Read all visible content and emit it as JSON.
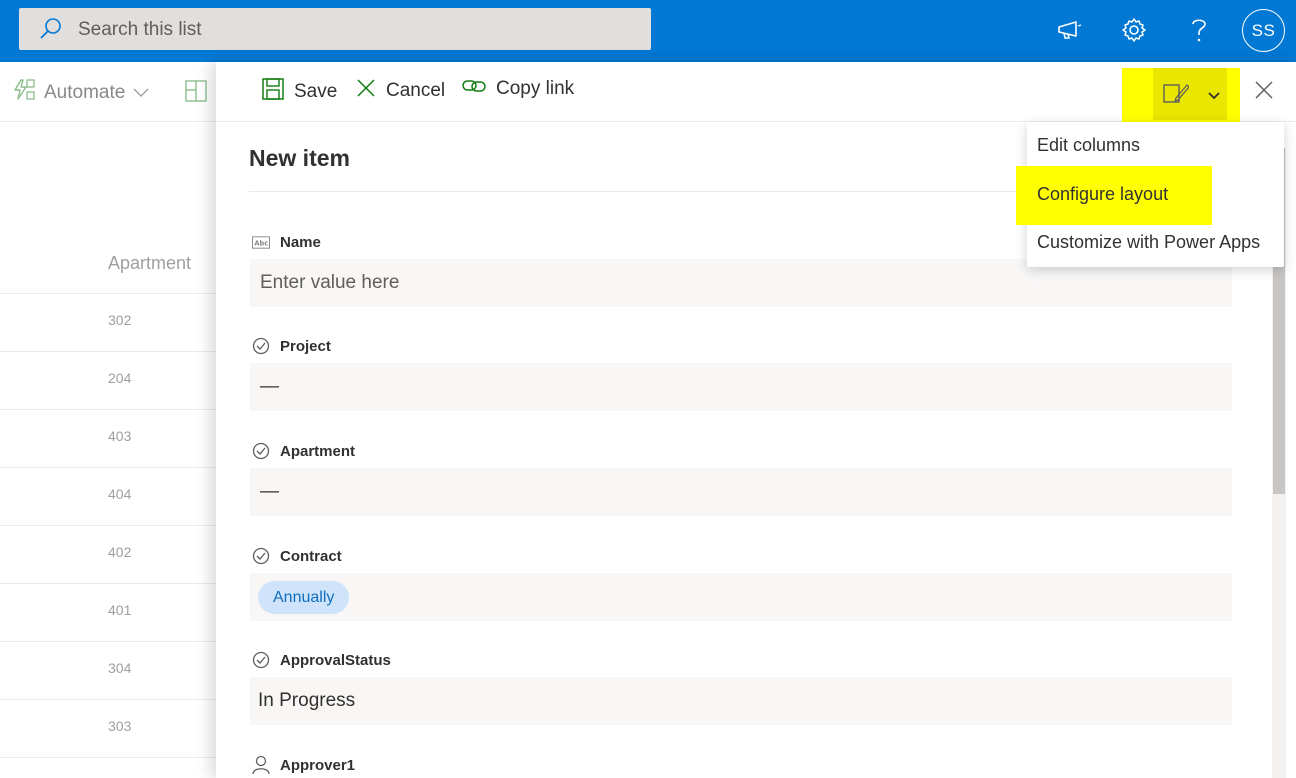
{
  "suitebar": {
    "search_placeholder": "Search this list",
    "avatar_initials": "SS"
  },
  "background_list": {
    "automate_label": "Automate",
    "column_header": "Apartment",
    "rows": [
      "302",
      "204",
      "403",
      "404",
      "402",
      "401",
      "304",
      "303"
    ]
  },
  "panel": {
    "commands": {
      "save": "Save",
      "cancel": "Cancel",
      "copy_link": "Copy link"
    },
    "title": "New item",
    "fields": {
      "name": {
        "label": "Name",
        "placeholder": "Enter value here"
      },
      "project": {
        "label": "Project",
        "value": "—"
      },
      "apartment": {
        "label": "Apartment",
        "value": "—"
      },
      "contract": {
        "label": "Contract",
        "value": "Annually"
      },
      "approval_status": {
        "label": "ApprovalStatus",
        "value": "In Progress"
      },
      "approver1": {
        "label": "Approver1"
      }
    }
  },
  "form_menu": {
    "items": [
      "Edit columns",
      "Configure layout",
      "Customize with Power Apps"
    ]
  },
  "colors": {
    "suitebar": "#0078d4",
    "highlight": "#ffff00",
    "pill_bg": "#cfe4fa",
    "pill_text": "#106ebe",
    "field_bg": "#f8f7f6"
  }
}
